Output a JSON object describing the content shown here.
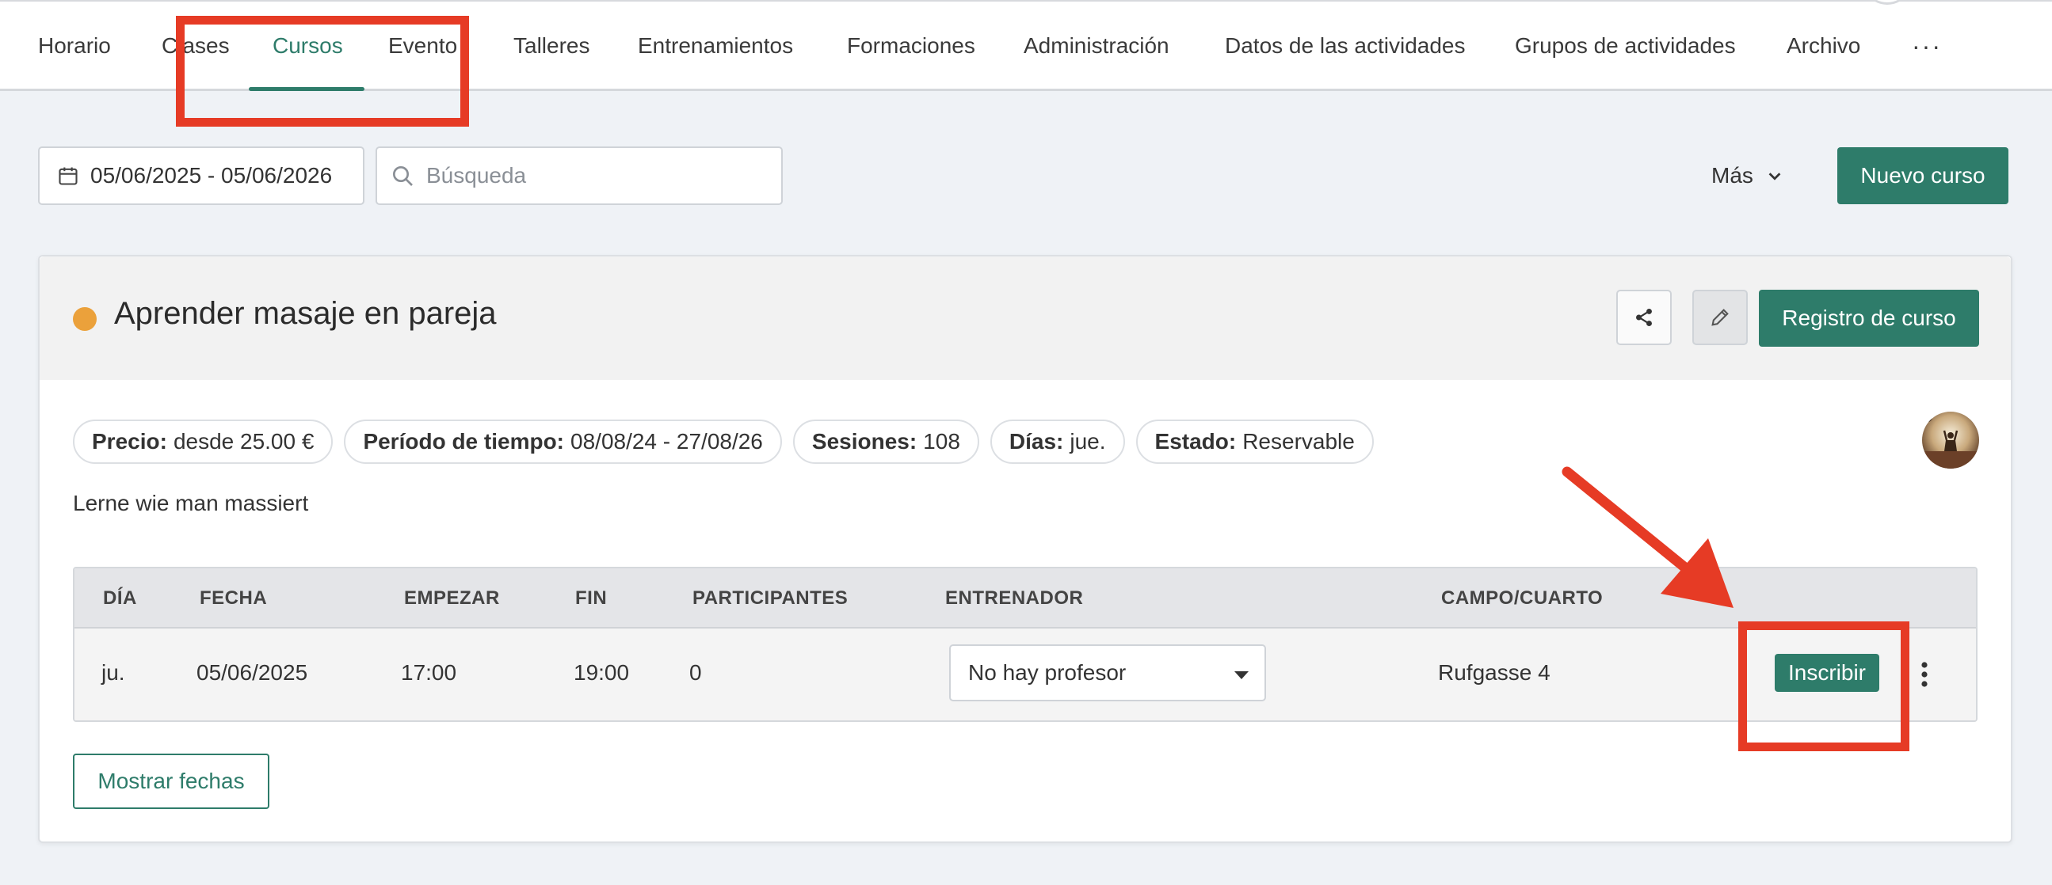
{
  "nav": {
    "items": [
      {
        "label": "Horario"
      },
      {
        "label": "Clases"
      },
      {
        "label": "Cursos"
      },
      {
        "label": "Evento"
      },
      {
        "label": "Talleres"
      },
      {
        "label": "Entrenamientos"
      },
      {
        "label": "Formaciones"
      },
      {
        "label": "Administración"
      },
      {
        "label": "Datos de las actividades"
      },
      {
        "label": "Grupos de actividades"
      },
      {
        "label": "Archivo"
      }
    ],
    "active": "Cursos",
    "more_label": "···",
    "more_icon": "ellipsis-horizontal-icon"
  },
  "toolbar": {
    "date_range": "05/06/2025 - 05/06/2026",
    "date_icon": "calendar-icon",
    "search_placeholder": "Búsqueda",
    "search_value": "",
    "search_icon": "search-icon",
    "more_label": "Más",
    "new_course_label": "Nuevo curso"
  },
  "course": {
    "title": "Aprender masaje en pareja",
    "status_color": "#eba13b",
    "register_label": "Registro de curso",
    "description": "Lerne wie man massiert",
    "chips": {
      "price_label": "Precio:",
      "price_value": "desde 25.00 €",
      "period_label": "Período de tiempo:",
      "period_value": "08/08/24 - 27/08/26",
      "sessions_label": "Sesiones:",
      "sessions_value": "108",
      "days_label": "Días:",
      "days_value": "jue.",
      "state_label": "Estado:",
      "state_value": "Reservable"
    }
  },
  "table": {
    "headers": {
      "day": "DÍA",
      "date": "FECHA",
      "start": "EMPEZAR",
      "end": "FIN",
      "participants": "PARTICIPANTES",
      "trainer": "ENTRENADOR",
      "room": "CAMPO/CUARTO"
    },
    "rows": [
      {
        "day": "ju.",
        "date": "05/06/2025",
        "start": "17:00",
        "end": "19:00",
        "participants": "0",
        "trainer": "No hay profesor",
        "room": "Rufgasse 4",
        "enroll_label": "Inscribir"
      }
    ]
  },
  "show_dates_label": "Mostrar fechas",
  "colors": {
    "accent": "#2e7c6a",
    "annotation": "#e63b25",
    "background": "#eff2f6"
  }
}
